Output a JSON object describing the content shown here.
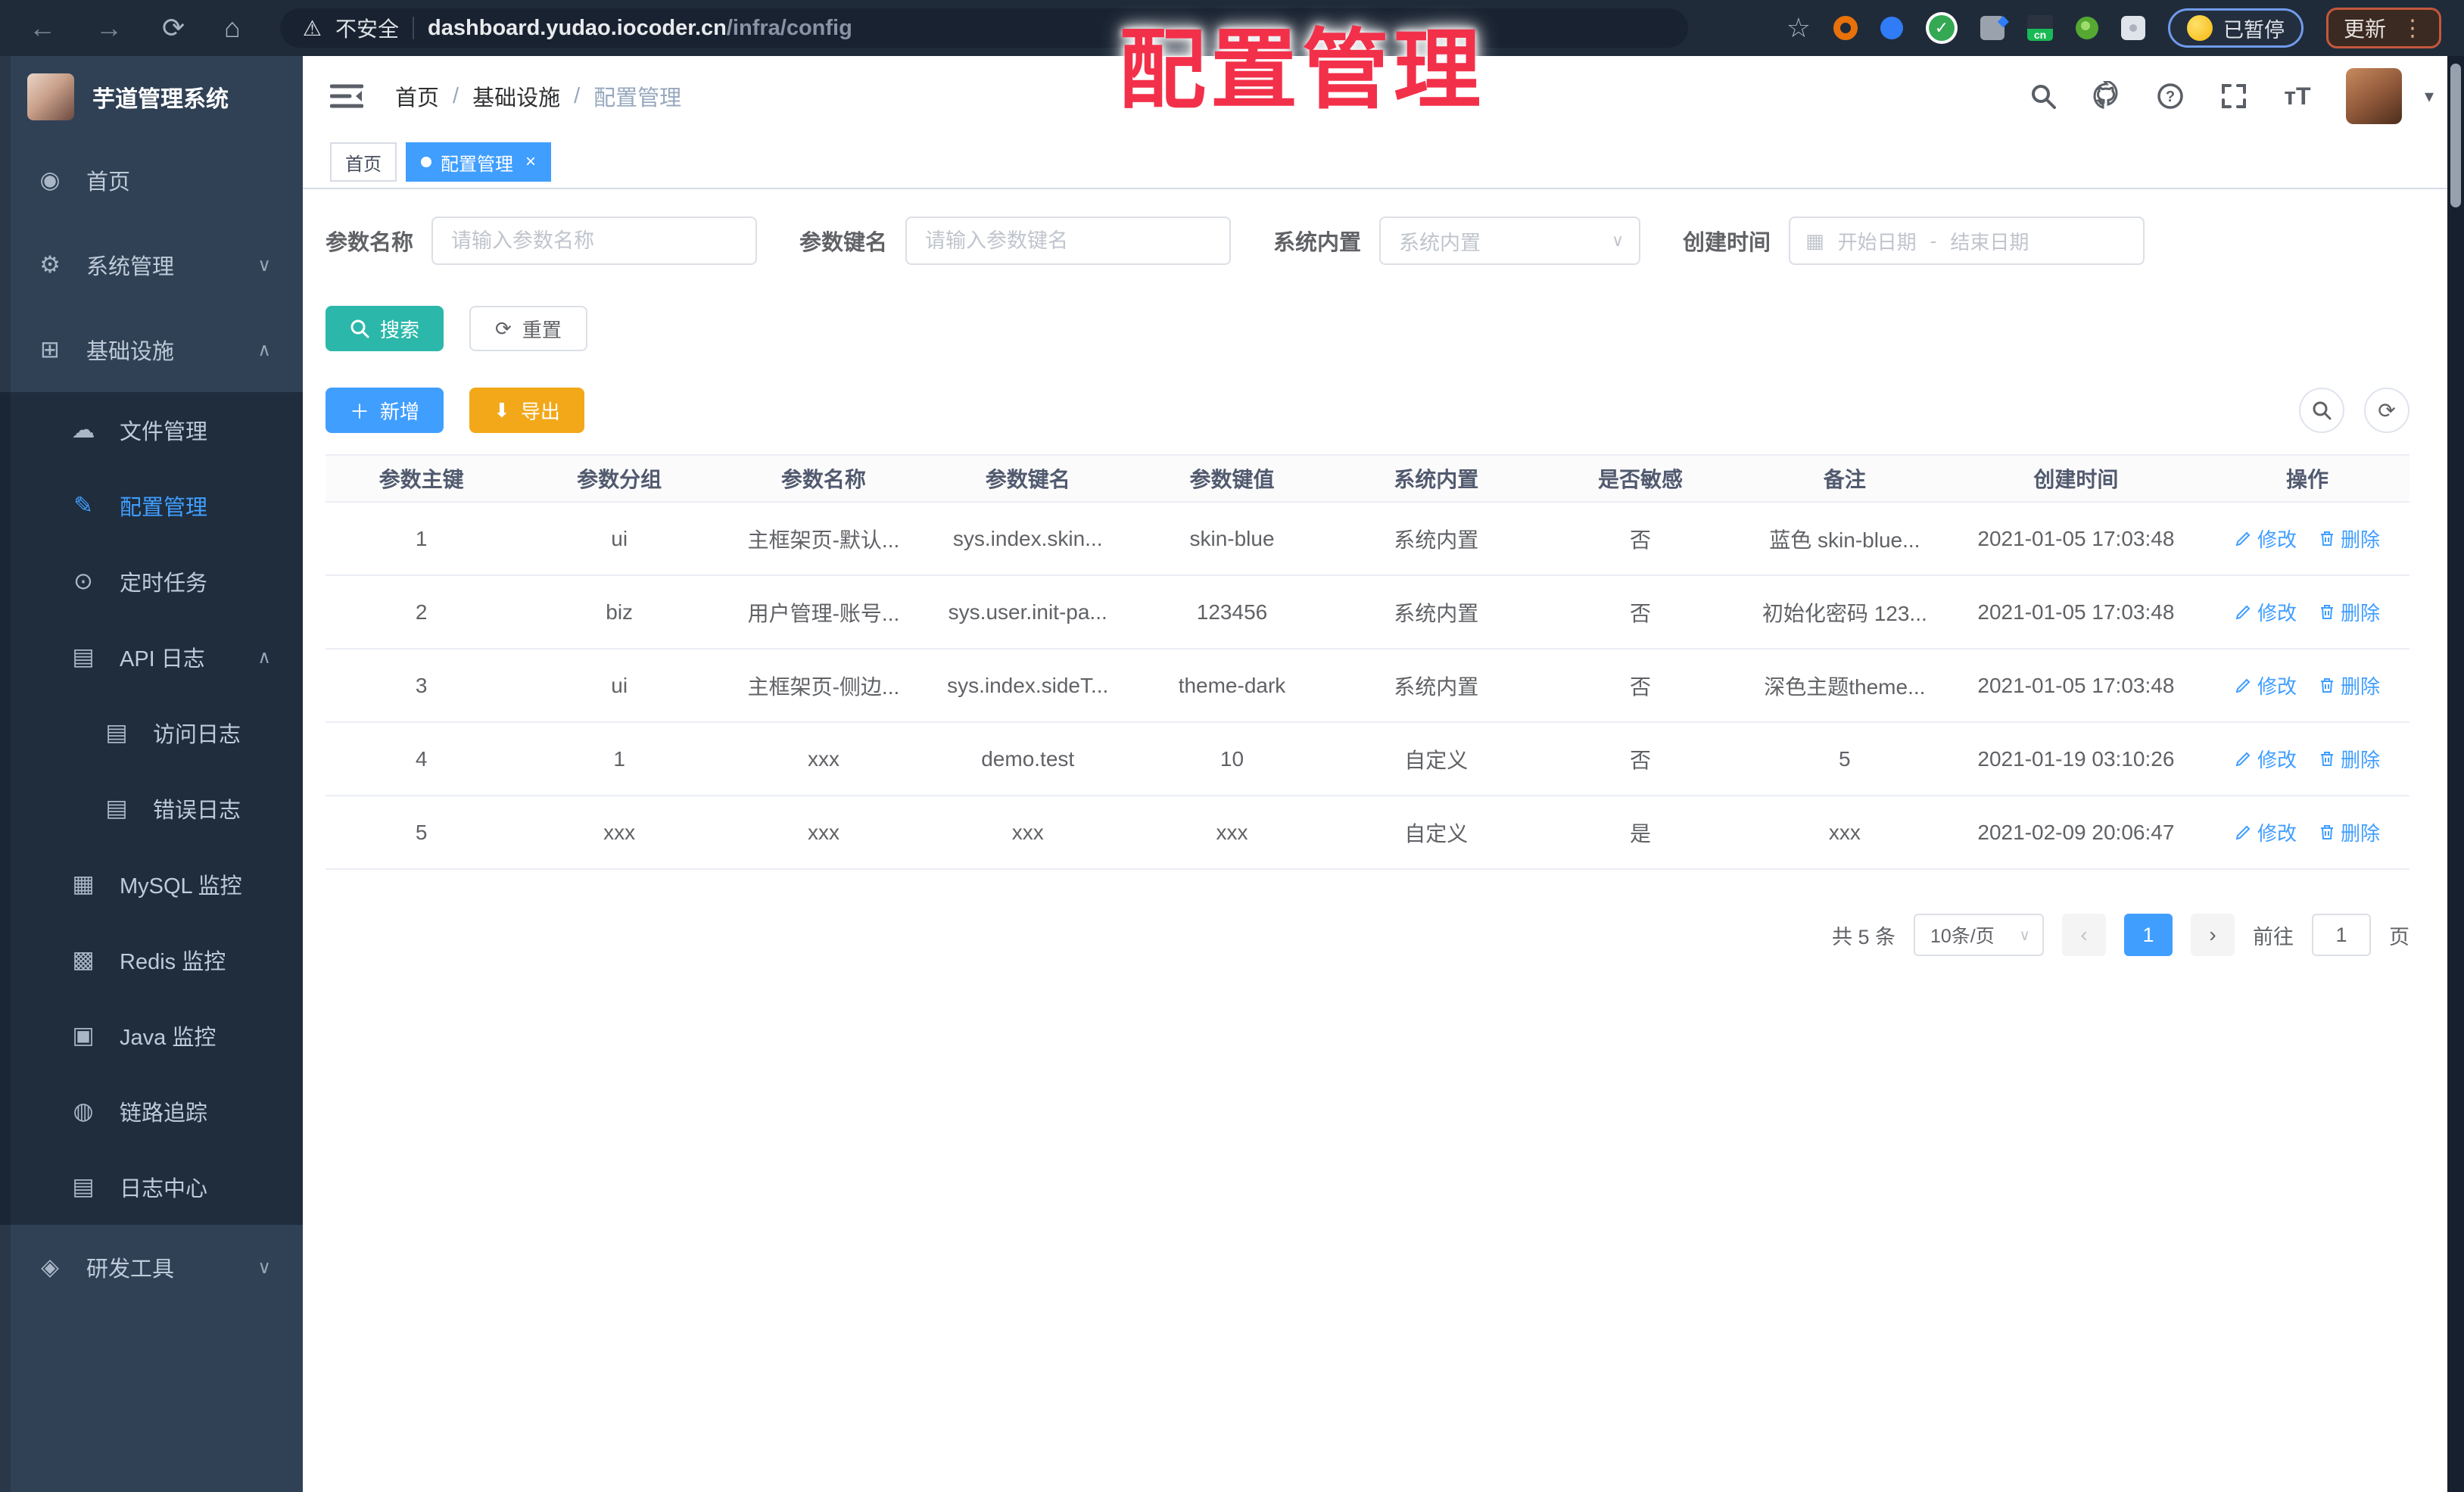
{
  "browser": {
    "security_label": "不安全",
    "url_host": "dashboard.yudao.iocoder.cn",
    "url_path": "/infra/config",
    "paused_label": "已暂停",
    "update_label": "更新"
  },
  "overlay": {
    "title": "配置管理",
    "color": "#f3304a"
  },
  "icon_glyphs": {
    "back-icon": "←",
    "forward-icon": "→",
    "reload-icon": "⟳",
    "home-icon": "⌂",
    "warning-icon": "⚠",
    "star-icon": "☆",
    "dots-vertical-icon": "⋮",
    "caret-down-icon": "▾",
    "chevron-down-icon": "∨",
    "chevron-up-icon": "∧",
    "calendar-icon": "▦",
    "refresh-icon": "⟳",
    "plus-icon": "＋",
    "download-icon": "⬇",
    "dashboard-icon": "◉",
    "gear-icon": "⚙",
    "infra-icon": "⊞",
    "cloud-icon": "☁",
    "edit-icon": "✎",
    "timer-icon": "⊙",
    "api-log-icon": "▤",
    "access-log-icon": "▤",
    "error-log-icon": "▤",
    "mysql-icon": "▦",
    "redis-icon": "▩",
    "java-icon": "▣",
    "trace-icon": "◍",
    "log-center-icon": "▤",
    "tools-icon": "◈"
  },
  "sidebar": {
    "app_title": "芋道管理系统",
    "items": [
      {
        "name": "home",
        "label": "首页",
        "icon": "dashboard-icon",
        "level": 1
      },
      {
        "name": "system-management",
        "label": "系统管理",
        "icon": "gear-icon",
        "level": 1,
        "chevron": "down"
      },
      {
        "name": "infrastructure",
        "label": "基础设施",
        "icon": "infra-icon",
        "level": 1,
        "chevron": "up"
      },
      {
        "name": "file-management",
        "label": "文件管理",
        "icon": "cloud-icon",
        "level": 2
      },
      {
        "name": "config-management",
        "label": "配置管理",
        "icon": "edit-icon",
        "level": 2,
        "active": true
      },
      {
        "name": "scheduled-tasks",
        "label": "定时任务",
        "icon": "timer-icon",
        "level": 2
      },
      {
        "name": "api-log",
        "label": "API 日志",
        "icon": "api-log-icon",
        "level": 2,
        "chevron": "up"
      },
      {
        "name": "access-log",
        "label": "访问日志",
        "icon": "access-log-icon",
        "level": 3
      },
      {
        "name": "error-log",
        "label": "错误日志",
        "icon": "error-log-icon",
        "level": 3
      },
      {
        "name": "mysql-monitor",
        "label": "MySQL 监控",
        "icon": "mysql-icon",
        "level": 2
      },
      {
        "name": "redis-monitor",
        "label": "Redis 监控",
        "icon": "redis-icon",
        "level": 2
      },
      {
        "name": "java-monitor",
        "label": "Java 监控",
        "icon": "java-icon",
        "level": 2
      },
      {
        "name": "trace",
        "label": "链路追踪",
        "icon": "trace-icon",
        "level": 2
      },
      {
        "name": "log-center",
        "label": "日志中心",
        "icon": "log-center-icon",
        "level": 2
      },
      {
        "name": "dev-tools",
        "label": "研发工具",
        "icon": "tools-icon",
        "level": 1,
        "chevron": "down"
      }
    ]
  },
  "header": {
    "breadcrumb": [
      "首页",
      "基础设施",
      "配置管理"
    ],
    "separator": "/"
  },
  "tabs": [
    {
      "name": "home",
      "label": "首页",
      "active": false,
      "closable": false
    },
    {
      "name": "config-management",
      "label": "配置管理",
      "active": true,
      "closable": true
    }
  ],
  "filters": {
    "name": {
      "label": "参数名称",
      "placeholder": "请输入参数名称"
    },
    "key": {
      "label": "参数键名",
      "placeholder": "请输入参数键名"
    },
    "type": {
      "label": "系统内置",
      "placeholder": "系统内置"
    },
    "date": {
      "label": "创建时间",
      "start_placeholder": "开始日期",
      "separator": "-",
      "end_placeholder": "结束日期"
    }
  },
  "actions": {
    "search": "搜索",
    "reset": "重置",
    "add": "新增",
    "export": "导出"
  },
  "table": {
    "columns": [
      "参数主键",
      "参数分组",
      "参数名称",
      "参数键名",
      "参数键值",
      "系统内置",
      "是否敏感",
      "备注",
      "创建时间",
      "操作"
    ],
    "col_widths": [
      "9.2%",
      "9.8%",
      "9.8%",
      "9.8%",
      "9.8%",
      "9.8%",
      "9.8%",
      "9.8%",
      "12.4%",
      "9.8%"
    ],
    "edit_label": "修改",
    "delete_label": "删除",
    "rows": [
      [
        "1",
        "ui",
        "主框架页-默认...",
        "sys.index.skin...",
        "skin-blue",
        "系统内置",
        "否",
        "蓝色 skin-blue...",
        "2021-01-05 17:03:48"
      ],
      [
        "2",
        "biz",
        "用户管理-账号...",
        "sys.user.init-pa...",
        "123456",
        "系统内置",
        "否",
        "初始化密码 123...",
        "2021-01-05 17:03:48"
      ],
      [
        "3",
        "ui",
        "主框架页-侧边...",
        "sys.index.sideT...",
        "theme-dark",
        "系统内置",
        "否",
        "深色主题theme...",
        "2021-01-05 17:03:48"
      ],
      [
        "4",
        "1",
        "xxx",
        "demo.test",
        "10",
        "自定义",
        "否",
        "5",
        "2021-01-19 03:10:26"
      ],
      [
        "5",
        "xxx",
        "xxx",
        "xxx",
        "xxx",
        "自定义",
        "是",
        "xxx",
        "2021-02-09 20:06:47"
      ]
    ]
  },
  "pagination": {
    "total_label": "共 5 条",
    "page_size_value": "10条/页",
    "prev": "‹",
    "current_page": "1",
    "next": "›",
    "goto_label": "前往",
    "goto_value": "1",
    "page_suffix": "页"
  }
}
